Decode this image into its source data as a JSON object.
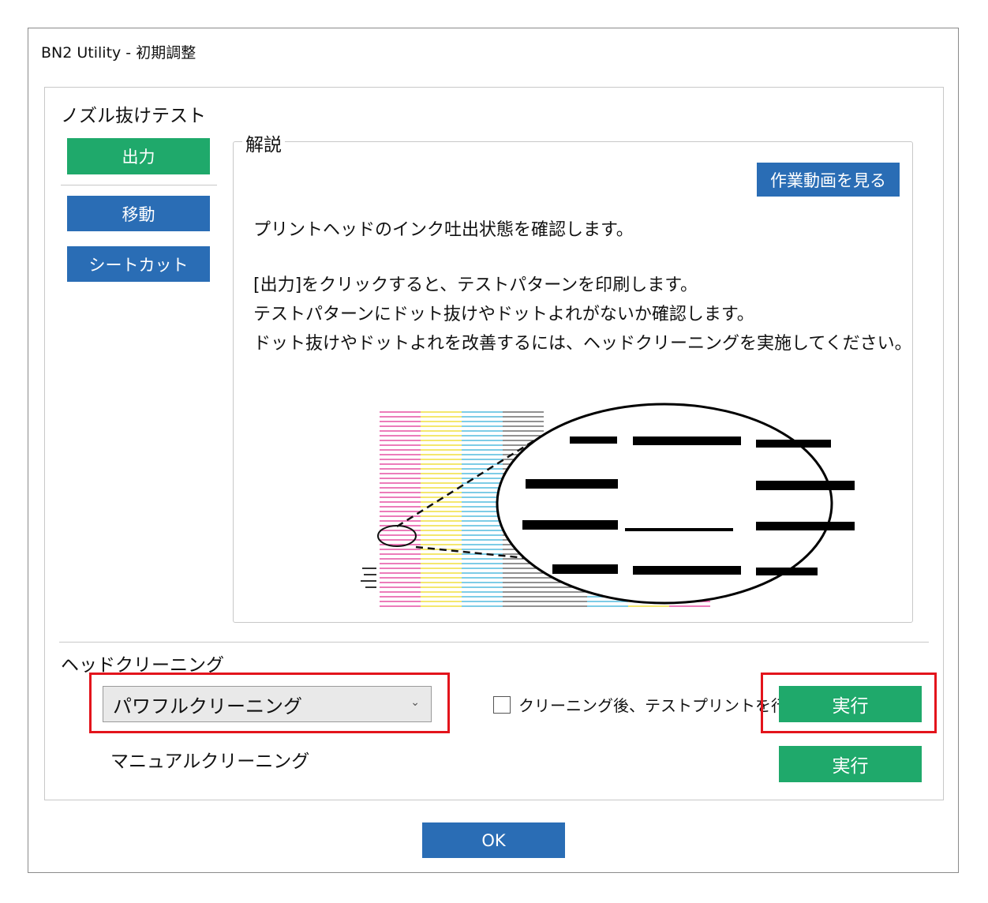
{
  "window": {
    "title": "BN2 Utility - 初期調整"
  },
  "nozzle_test": {
    "label": "ノズル抜けテスト",
    "output_label": "出力",
    "move_label": "移動",
    "sheet_cut_label": "シートカット"
  },
  "explanation": {
    "legend": "解説",
    "video_button_label": "作業動画を見る",
    "line1": "プリントヘッドのインク吐出状態を確認します。",
    "line2": "[出力]をクリックすると、テストパターンを印刷します。",
    "line3": "テストパターンにドット抜けやドットよれがないか確認します。",
    "line4": "ドット抜けやドットよれを改善するには、ヘッドクリーニングを実施してください。"
  },
  "head_cleaning": {
    "label": "ヘッドクリーニング",
    "selected_option": "パワフルクリーニング",
    "checkbox_label": "クリーニング後、テストプリントを行う",
    "checkbox_checked": false,
    "execute_label": "実行",
    "manual_label": "マニュアルクリーニング",
    "manual_execute_label": "実行"
  },
  "footer": {
    "ok_label": "OK"
  },
  "colors": {
    "green": "#1fa96b",
    "blue": "#2a6db5",
    "highlight_red": "#e3141c",
    "pattern_magenta": "#e85aa8",
    "pattern_yellow": "#f2e14a",
    "pattern_cyan": "#5cc0e0",
    "pattern_black": "#555555"
  },
  "icons": {
    "dropdown": "chevron-down-icon"
  }
}
